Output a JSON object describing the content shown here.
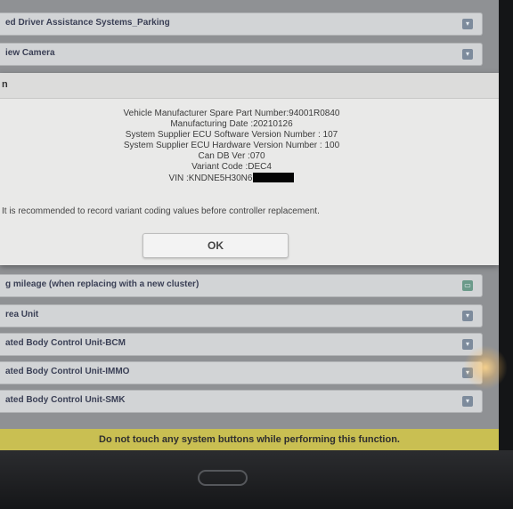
{
  "list_rows_top": [
    {
      "label": "ed Driver Assistance Systems_Parking"
    },
    {
      "label": "iew Camera"
    }
  ],
  "dialog": {
    "header": "n",
    "lines": [
      "Vehicle Manufacturer Spare Part Number:94001R0840",
      "Manufacturing Date :20210126",
      "System Supplier ECU Software Version Number : 107",
      "System Supplier ECU Hardware Version Number : 100",
      "Can DB Ver :070",
      "Variant Code :DEC4"
    ],
    "vin_label": "VIN :KNDNE5H30N6",
    "note": "It is recommended to record variant coding values before controller replacement.",
    "ok_label": "OK"
  },
  "list_rows_bottom": [
    {
      "label": "g mileage (when replacing with a new cluster)"
    },
    {
      "label": "rea Unit"
    },
    {
      "label": "ated Body Control Unit-BCM"
    },
    {
      "label": "ated Body Control Unit-IMMO"
    },
    {
      "label": "ated Body Control Unit-SMK"
    }
  ],
  "warning": "Do not touch any system buttons while performing this function."
}
